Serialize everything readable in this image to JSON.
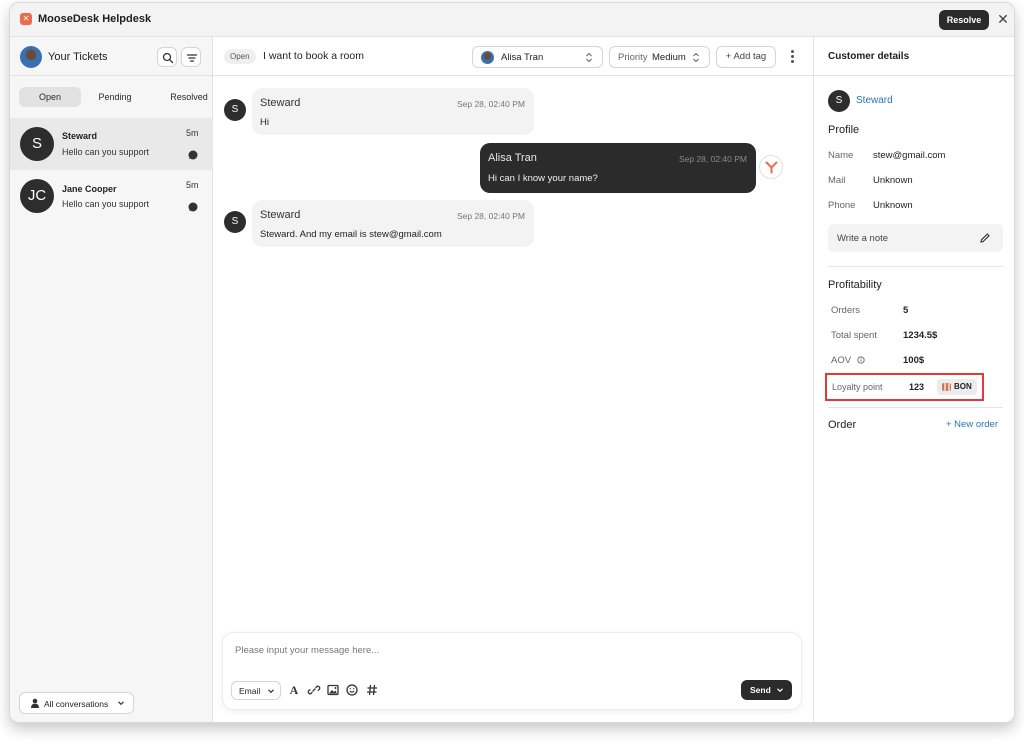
{
  "app": {
    "title": "MooseDesk Helpdesk",
    "logo_glyph": "✕",
    "resolve_label": "Resolve",
    "close_glyph": "✕"
  },
  "sidebar": {
    "heading": "Your Tickets",
    "tabs": [
      {
        "label": "Open",
        "active": true
      },
      {
        "label": "Pending",
        "active": false
      },
      {
        "label": "Resolved",
        "active": false
      }
    ],
    "tickets": [
      {
        "initials": "S",
        "name": "Steward",
        "message": "Hello can you support",
        "time": "5m",
        "selected": true
      },
      {
        "initials": "JC",
        "name": "Jane Cooper",
        "message": "Hello can you support",
        "time": "5m",
        "selected": false
      }
    ],
    "filter_label": "All conversations"
  },
  "conversation": {
    "status": "Open",
    "subject": "I want to book a room",
    "assignee": "Alisa Tran",
    "priority_label": "Priority",
    "priority_value": "Medium",
    "add_tag_label": "+ Add tag",
    "messages": [
      {
        "initials": "S",
        "author": "Steward",
        "time": "Sep 28, 02:40 PM",
        "text": "Hi",
        "direction": "in"
      },
      {
        "author": "Alisa Tran",
        "time": "Sep 28, 02:40 PM",
        "text": "Hi can I know your name?",
        "direction": "out"
      },
      {
        "initials": "S",
        "author": "Steward",
        "time": "Sep 28, 02:40 PM",
        "text": "Steward. And my email is stew@gmail.com",
        "direction": "in"
      }
    ]
  },
  "composer": {
    "placeholder": "Please input your message here...",
    "channel": "Email",
    "send_label": "Send",
    "tools": [
      "text-format-icon",
      "link-icon",
      "image-icon",
      "emoji-icon",
      "hashtag-icon"
    ]
  },
  "customer": {
    "panel_title": "Customer details",
    "initials": "S",
    "name": "Steward",
    "profile_title": "Profile",
    "profile": [
      {
        "label": "Name",
        "value": "stew@gmail.com"
      },
      {
        "label": "Mail",
        "value": "Unknown"
      },
      {
        "label": "Phone",
        "value": "Unknown"
      }
    ],
    "note_label": "Write a note",
    "profitability_title": "Profitability",
    "profitability": [
      {
        "label": "Orders",
        "value": "5"
      },
      {
        "label": "Total spent",
        "value": "1234.5$"
      },
      {
        "label": "AOV",
        "value": "100$"
      }
    ],
    "loyalty": {
      "label": "Loyalty point",
      "value": "123",
      "badge": "BON"
    },
    "order_title": "Order",
    "new_order_label": "+ New order"
  },
  "colors": {
    "accent_blue": "#2b73c8",
    "dark": "#2b2b2b",
    "highlight_red": "#e53935",
    "logo_orange": "#f06a4a"
  }
}
